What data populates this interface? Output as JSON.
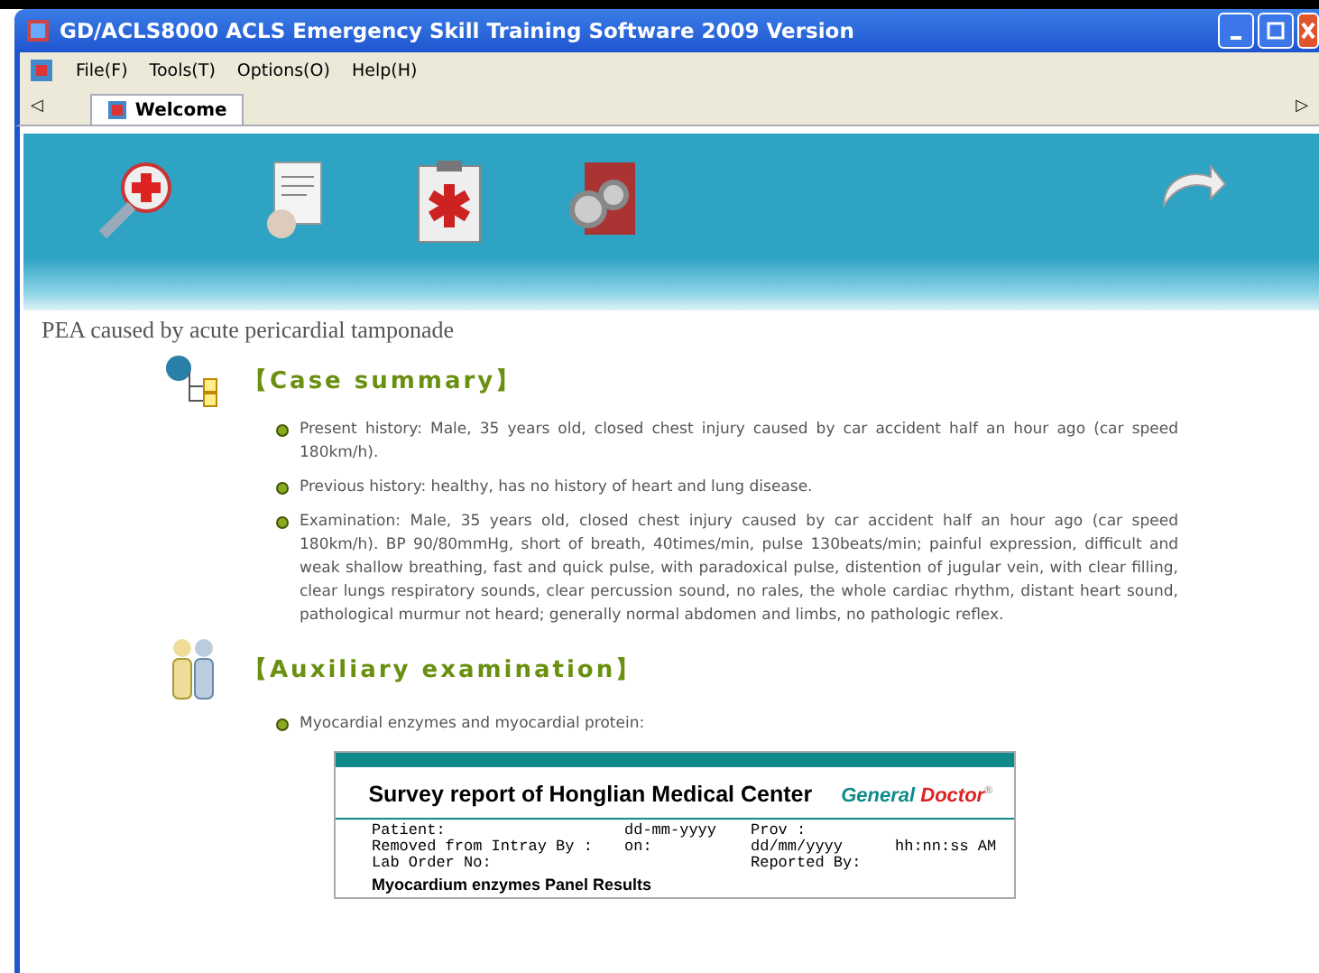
{
  "window": {
    "title": "GD/ACLS8000 ACLS Emergency Skill Training Software 2009 Version"
  },
  "menu": [
    "File(F)",
    "Tools(T)",
    "Options(O)",
    "Help(H)"
  ],
  "tabs": [
    {
      "label": "Welcome",
      "selected": true
    }
  ],
  "tab_scroll": {
    "left": "◁",
    "right": "▷"
  },
  "page_title": "PEA caused by acute pericardial tamponade",
  "sections": [
    {
      "kind": "tree",
      "heading": "【Case summary】",
      "items": [
        "Present history: Male, 35 years old, closed chest injury caused by car accident half an hour ago (car speed 180km/h).",
        "Previous history: healthy, has no history of heart and lung disease.",
        "Examination: Male, 35 years old, closed chest injury caused by car accident half an hour ago (car speed 180km/h). BP 90/80mmHg, short of breath, 40times/min, pulse 130beats/min; painful expression, difficult and weak shallow breathing, fast and quick pulse, with paradoxical pulse, distention of jugular vein, with clear filling, clear lungs respiratory sounds, clear percussion sound, no rales, the whole cardiac rhythm, distant heart sound, pathological murmur not heard; generally normal abdomen and limbs, no pathologic reflex."
      ]
    },
    {
      "kind": "people",
      "heading": "【Auxiliary examination】",
      "items": [
        "Myocardial enzymes and myocardial protein:"
      ]
    }
  ],
  "report": {
    "title": "Survey report of Honglian Medical Center",
    "brand_first": "General",
    "brand_second": "Doctor",
    "brand_mark": "®",
    "lines": [
      {
        "left": "Patient:",
        "middle": "dd-mm-yyyy",
        "right": "Prov :"
      },
      {
        "left": "Removed from Intray By :",
        "middle": "on:",
        "right": "dd/mm/yyyy",
        "far_right": "hh:nn:ss AM"
      },
      {
        "left": "Lab Order No:",
        "right": "Reported By:"
      }
    ],
    "panel": "Myocardium enzymes Panel Results"
  }
}
